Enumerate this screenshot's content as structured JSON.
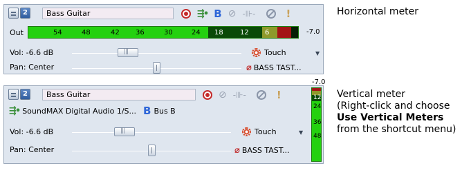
{
  "panel_horizontal": {
    "track_name": "Bass Guitar",
    "out_label": "Out",
    "meter_ticks": [
      "54",
      "48",
      "42",
      "36",
      "30",
      "24",
      "18",
      "12",
      "6"
    ],
    "peak_value": "-7.0",
    "volume": {
      "label": "Vol:",
      "value": "-6.6 dB",
      "level": 0.33
    },
    "pan": {
      "label": "Pan:",
      "value": "Center",
      "level": 0.5
    },
    "automation_mode": "Touch",
    "fx_chain": "BASS TAST..."
  },
  "panel_vertical": {
    "track_name": "Bass Guitar",
    "device_label": "SoundMAX Digital Audio 1/S...",
    "bus": "Bus B",
    "peak_value": "-7.0",
    "meter_ticks": [
      "12",
      "24",
      "36",
      "48"
    ],
    "volume": {
      "label": "Vol:",
      "value": "-6.6 dB",
      "level": 0.33
    },
    "pan": {
      "label": "Pan:",
      "value": "Center",
      "level": 0.5
    },
    "automation_mode": "Touch",
    "fx_chain": "BASS TAST..."
  },
  "captions": {
    "horizontal": "Horizontal meter",
    "vertical_line1": "Vertical meter",
    "vertical_line2": "(Right-click and choose",
    "vertical_line3": "Use Vertical Meters",
    "vertical_line4": "from the shortcut menu)"
  },
  "colors": {
    "panel_bg": "#dfe6ef",
    "meter_green": "#24d10f",
    "meter_red": "#a31515",
    "record_red": "#c42a2a",
    "bus_blue": "#2e66d8"
  }
}
